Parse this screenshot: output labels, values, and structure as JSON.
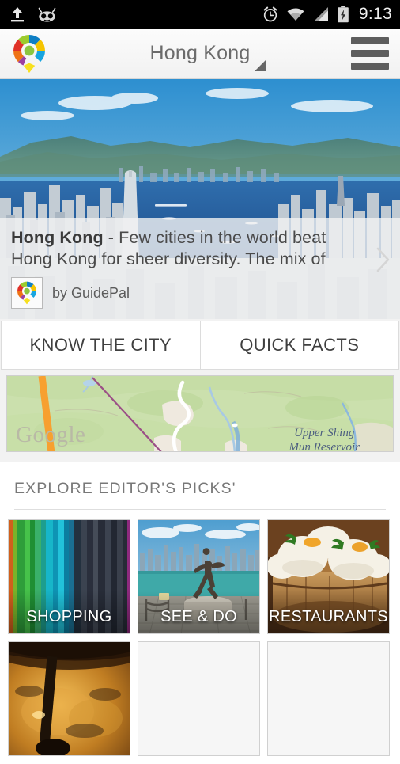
{
  "statusbar": {
    "time": "9:13",
    "icons": [
      "upload-icon",
      "cyanogenmod-icon",
      "alarm-icon",
      "wifi-icon",
      "signal-icon",
      "battery-charging-icon"
    ]
  },
  "actionbar": {
    "title": "Hong Kong",
    "logo": "guidepal-logo-icon",
    "spinner": "dropdown-triangle-icon",
    "menu": "hamburger-menu-icon"
  },
  "hero": {
    "image_alt": "Hong Kong Victoria Harbour skyline panorama",
    "headline": "Hong Kong",
    "separator": " - ",
    "body": "Few cities in the world beat Hong Kong for sheer diversity. The mix of",
    "credit": "by GuidePal",
    "next_icon": "chevron-right-icon"
  },
  "tabs": [
    {
      "label": "KNOW THE CITY"
    },
    {
      "label": "QUICK FACTS"
    }
  ],
  "map": {
    "watermark": "Google",
    "label_line1": "Upper Shing",
    "label_line2": "Mun Reservoir"
  },
  "explore": {
    "header": "EXPLORE EDITOR'S PICKS'",
    "cards": [
      {
        "label": "SHOPPING",
        "image": "colorful-fabrics"
      },
      {
        "label": "SEE & DO",
        "image": "bruce-lee-statue-harbour"
      },
      {
        "label": "RESTAURANTS",
        "image": "dim-sum-basket"
      },
      {
        "label": "",
        "image": "warm-amber-interior"
      },
      {
        "label": "",
        "image": ""
      },
      {
        "label": "",
        "image": ""
      }
    ]
  },
  "colors": {
    "statusbar_bg": "#000000",
    "actionbar_bg": "#f4f4f4",
    "page_bg": "#f2f2f2",
    "card_bg": "#f6f6f6",
    "text_primary": "#3f3f3f",
    "text_muted": "#787878"
  }
}
